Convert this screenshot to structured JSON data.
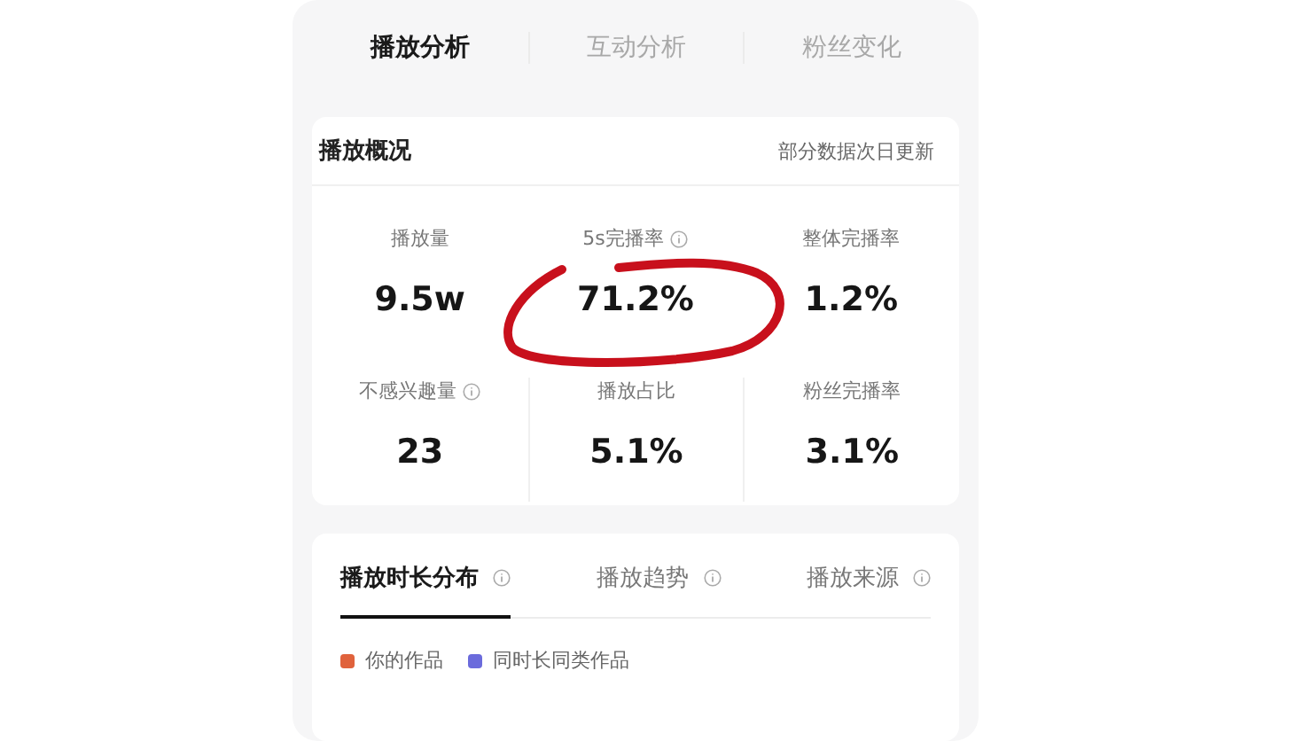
{
  "top_tabs": [
    {
      "label": "播放分析",
      "selected": true
    },
    {
      "label": "互动分析",
      "selected": false
    },
    {
      "label": "粉丝变化",
      "selected": false
    }
  ],
  "overview": {
    "title": "播放概况",
    "note": "部分数据次日更新",
    "stats": [
      {
        "label": "播放量",
        "value": "9.5w",
        "info": false
      },
      {
        "label": "5s完播率",
        "value": "71.2%",
        "info": true
      },
      {
        "label": "整体完播率",
        "value": "1.2%",
        "info": false
      },
      {
        "label": "不感兴趣量",
        "value": "23",
        "info": true
      },
      {
        "label": "播放占比",
        "value": "5.1%",
        "info": false
      },
      {
        "label": "粉丝完播率",
        "value": "3.1%",
        "info": false
      }
    ]
  },
  "detail_tabs": [
    {
      "label": "播放时长分布",
      "selected": true
    },
    {
      "label": "播放趋势",
      "selected": false
    },
    {
      "label": "播放来源",
      "selected": false
    }
  ],
  "legend": [
    {
      "label": "你的作品",
      "color": "#e0623c"
    },
    {
      "label": "同时长同类作品",
      "color": "#6b6bdc"
    }
  ],
  "annotation": {
    "kind": "circle"
  }
}
